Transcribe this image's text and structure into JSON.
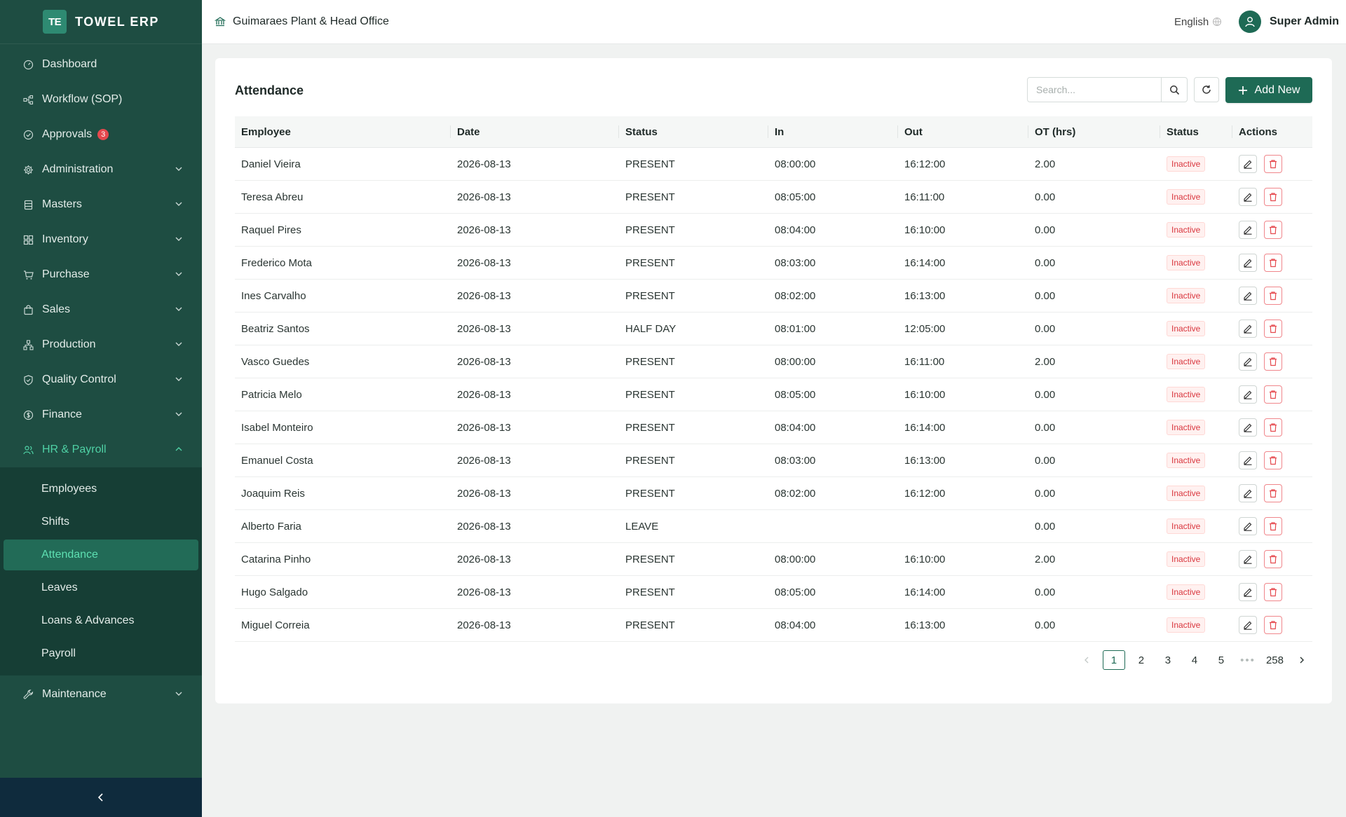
{
  "app": {
    "logo_text": "TE",
    "name": "TOWEL ERP"
  },
  "sidebar": {
    "items": [
      {
        "label": "Dashboard",
        "icon": "dashboard-icon",
        "chevron": false
      },
      {
        "label": "Workflow (SOP)",
        "icon": "workflow-icon",
        "chevron": false
      },
      {
        "label": "Approvals",
        "icon": "check-circle-icon",
        "chevron": false,
        "badge": "3"
      },
      {
        "label": "Administration",
        "icon": "gear-icon",
        "chevron": true
      },
      {
        "label": "Masters",
        "icon": "database-icon",
        "chevron": true
      },
      {
        "label": "Inventory",
        "icon": "grid-icon",
        "chevron": true
      },
      {
        "label": "Purchase",
        "icon": "cart-icon",
        "chevron": true
      },
      {
        "label": "Sales",
        "icon": "shopping-bag-icon",
        "chevron": true
      },
      {
        "label": "Production",
        "icon": "cluster-icon",
        "chevron": true
      },
      {
        "label": "Quality Control",
        "icon": "shield-check-icon",
        "chevron": true
      },
      {
        "label": "Finance",
        "icon": "dollar-icon",
        "chevron": true
      },
      {
        "label": "HR & Payroll",
        "icon": "team-icon",
        "chevron": true,
        "expanded": true
      }
    ],
    "hr_submenu": [
      "Employees",
      "Shifts",
      "Attendance",
      "Leaves",
      "Loans & Advances",
      "Payroll"
    ],
    "active_subitem": "Attendance",
    "maintenance": {
      "label": "Maintenance",
      "icon": "tool-icon"
    }
  },
  "header": {
    "plant": "Guimaraes Plant & Head Office",
    "language": "English",
    "user": "Super Admin"
  },
  "page": {
    "title": "Attendance",
    "search_placeholder": "Search...",
    "add_label": "Add New"
  },
  "table": {
    "columns": [
      "Employee",
      "Date",
      "Status",
      "In",
      "Out",
      "OT (hrs)",
      "Status",
      "Actions"
    ],
    "rows": [
      {
        "employee": "Daniel Vieira",
        "date": "2026-08-13",
        "status": "PRESENT",
        "in": "08:00:00",
        "out": "16:12:00",
        "ot": "2.00",
        "record_status": "Inactive"
      },
      {
        "employee": "Teresa Abreu",
        "date": "2026-08-13",
        "status": "PRESENT",
        "in": "08:05:00",
        "out": "16:11:00",
        "ot": "0.00",
        "record_status": "Inactive"
      },
      {
        "employee": "Raquel Pires",
        "date": "2026-08-13",
        "status": "PRESENT",
        "in": "08:04:00",
        "out": "16:10:00",
        "ot": "0.00",
        "record_status": "Inactive"
      },
      {
        "employee": "Frederico Mota",
        "date": "2026-08-13",
        "status": "PRESENT",
        "in": "08:03:00",
        "out": "16:14:00",
        "ot": "0.00",
        "record_status": "Inactive"
      },
      {
        "employee": "Ines Carvalho",
        "date": "2026-08-13",
        "status": "PRESENT",
        "in": "08:02:00",
        "out": "16:13:00",
        "ot": "0.00",
        "record_status": "Inactive"
      },
      {
        "employee": "Beatriz Santos",
        "date": "2026-08-13",
        "status": "HALF DAY",
        "in": "08:01:00",
        "out": "12:05:00",
        "ot": "0.00",
        "record_status": "Inactive"
      },
      {
        "employee": "Vasco Guedes",
        "date": "2026-08-13",
        "status": "PRESENT",
        "in": "08:00:00",
        "out": "16:11:00",
        "ot": "2.00",
        "record_status": "Inactive"
      },
      {
        "employee": "Patricia Melo",
        "date": "2026-08-13",
        "status": "PRESENT",
        "in": "08:05:00",
        "out": "16:10:00",
        "ot": "0.00",
        "record_status": "Inactive"
      },
      {
        "employee": "Isabel Monteiro",
        "date": "2026-08-13",
        "status": "PRESENT",
        "in": "08:04:00",
        "out": "16:14:00",
        "ot": "0.00",
        "record_status": "Inactive"
      },
      {
        "employee": "Emanuel Costa",
        "date": "2026-08-13",
        "status": "PRESENT",
        "in": "08:03:00",
        "out": "16:13:00",
        "ot": "0.00",
        "record_status": "Inactive"
      },
      {
        "employee": "Joaquim Reis",
        "date": "2026-08-13",
        "status": "PRESENT",
        "in": "08:02:00",
        "out": "16:12:00",
        "ot": "0.00",
        "record_status": "Inactive"
      },
      {
        "employee": "Alberto Faria",
        "date": "2026-08-13",
        "status": "LEAVE",
        "in": "",
        "out": "",
        "ot": "0.00",
        "record_status": "Inactive"
      },
      {
        "employee": "Catarina Pinho",
        "date": "2026-08-13",
        "status": "PRESENT",
        "in": "08:00:00",
        "out": "16:10:00",
        "ot": "2.00",
        "record_status": "Inactive"
      },
      {
        "employee": "Hugo Salgado",
        "date": "2026-08-13",
        "status": "PRESENT",
        "in": "08:05:00",
        "out": "16:14:00",
        "ot": "0.00",
        "record_status": "Inactive"
      },
      {
        "employee": "Miguel Correia",
        "date": "2026-08-13",
        "status": "PRESENT",
        "in": "08:04:00",
        "out": "16:13:00",
        "ot": "0.00",
        "record_status": "Inactive"
      }
    ]
  },
  "pagination": {
    "pages": [
      "1",
      "2",
      "3",
      "4",
      "5"
    ],
    "ellipsis": "•••",
    "last": "258",
    "current": "1"
  },
  "colors": {
    "sidebar": "#1e4d42",
    "accent": "#1e6a55",
    "active_text": "#4fd1a5",
    "danger": "#e5484d"
  }
}
